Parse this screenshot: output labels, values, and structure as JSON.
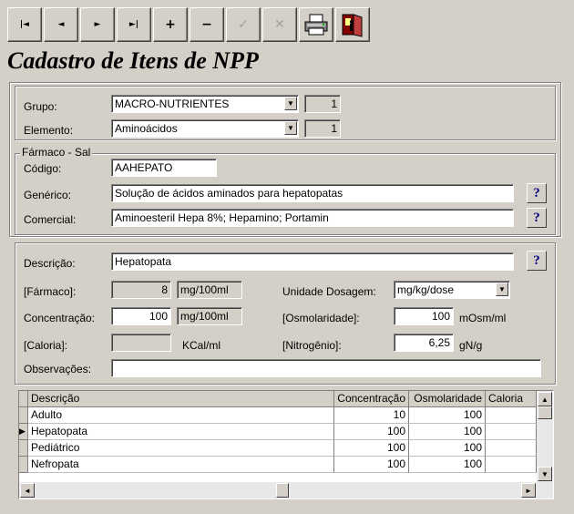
{
  "toolbar": {
    "first": "|◄",
    "prev": "◄",
    "next": "►",
    "last": "►|",
    "add": "+",
    "remove": "−",
    "confirm": "✓",
    "cancel": "✕"
  },
  "title": "Cadastro de Itens de NPP",
  "grupo": {
    "label": "Grupo:",
    "value": "MACRO-NUTRIENTES",
    "code": "1"
  },
  "elemento": {
    "label": "Elemento:",
    "value": "Aminoácidos",
    "code": "1"
  },
  "farmaco": {
    "group_label": "Fármaco - Sal",
    "codigo_label": "Código:",
    "codigo_value": "AAHEPATO",
    "generico_label": "Genérico:",
    "generico_value": "Solução de ácidos aminados para hepatopatas",
    "comercial_label": "Comercial:",
    "comercial_value": "Aminoesteril Hepa 8%; Hepamino; Portamin"
  },
  "help_glyph": "?",
  "detalhe": {
    "descricao_label": "Descrição:",
    "descricao_value": "Hepatopata",
    "farmaco_label": "[Fármaco]:",
    "farmaco_value": "8",
    "farmaco_unit": "mg/100ml",
    "unidade_label": "Unidade Dosagem:",
    "unidade_value": "mg/kg/dose",
    "concentracao_label": "Concentração:",
    "concentracao_value": "100",
    "concentracao_unit": "mg/100ml",
    "osmolaridade_label": "[Osmolaridade]:",
    "osmolaridade_value": "100",
    "osmolaridade_unit": "mOsm/ml",
    "caloria_label": "[Caloria]:",
    "caloria_value": "",
    "caloria_unit": "KCal/ml",
    "nitrogenio_label": "[Nitrogênio]:",
    "nitrogenio_value": "6,25",
    "nitrogenio_unit": "gN/g",
    "observacoes_label": "Observações:",
    "observacoes_value": ""
  },
  "grid": {
    "headers": [
      "Descrição",
      "Concentração",
      "Osmolaridade",
      "Caloria"
    ],
    "rows": [
      [
        "Adulto",
        "10",
        "100",
        ""
      ],
      [
        "Hepatopata",
        "100",
        "100",
        ""
      ],
      [
        "Pediátrico",
        "100",
        "100",
        ""
      ],
      [
        "Nefropata",
        "100",
        "100",
        ""
      ]
    ],
    "selected_row": 1
  }
}
